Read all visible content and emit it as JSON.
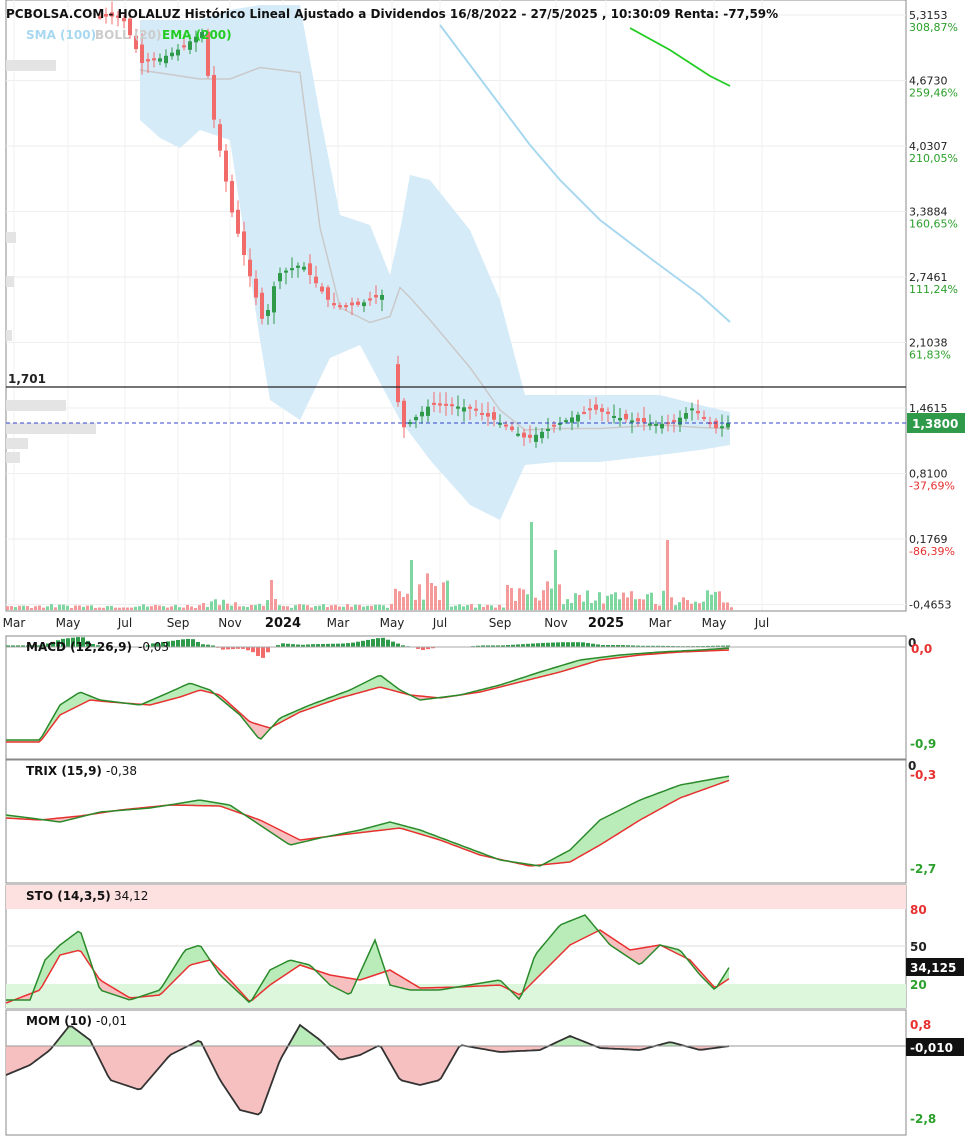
{
  "header": {
    "title": "PCBOLSA.COM - HOLALUZ Histórico Lineal Ajustado a Dividendos 16/8/2022 - 27/5/2025 , 10:30:09 Renta: -77,59%",
    "legend": [
      {
        "label": "SMA (100)",
        "color": "#a8d8f0"
      },
      {
        "label": "BOLL (20)",
        "color": "#cccccc"
      },
      {
        "label": "EMA (200)",
        "color": "#22cc22"
      }
    ]
  },
  "price_axis": [
    {
      "price": "5,3153",
      "pct": "308,87%"
    },
    {
      "price": "4,6730",
      "pct": "259,46%"
    },
    {
      "price": "4,0307",
      "pct": "210,05%"
    },
    {
      "price": "3,3884",
      "pct": "160,65%"
    },
    {
      "price": "2,7461",
      "pct": "111,24%"
    },
    {
      "price": "2,1038",
      "pct": "61,83%"
    },
    {
      "price": "1,4615",
      "pct": ""
    },
    {
      "price": "0,8100",
      "pct": "-37,69%"
    },
    {
      "price": "0,1769",
      "pct": "-86,39%"
    },
    {
      "price": "-0,4653",
      "pct": ""
    }
  ],
  "reference_line": {
    "label": "1,701"
  },
  "last_price": {
    "label": "1,3800",
    "color": "#2e9a4a"
  },
  "x_axis": {
    "months": [
      "Mar",
      "May",
      "Jul",
      "Sep",
      "Nov",
      "2024",
      "Mar",
      "May",
      "Jul",
      "Sep",
      "Nov",
      "2025",
      "Mar",
      "May",
      "Jul"
    ]
  },
  "macd": {
    "title": "MACD (12,26,9)",
    "value": "-0,03",
    "scale_top": "0",
    "scale_top_label": "0,0",
    "scale_bottom": "-0,9"
  },
  "trix": {
    "title": "TRIX (15,9)",
    "value": "-0,38",
    "scale_top": "0",
    "scale_top_label": "-0,3",
    "scale_bottom": "-2,7"
  },
  "sto": {
    "title": "STO (14,3,5)",
    "value": "34,12",
    "levels": [
      "80",
      "50",
      "20"
    ],
    "last": "34,125"
  },
  "mom": {
    "title": "MOM (10)",
    "value": "-0,01",
    "scale_top": "0,8",
    "scale_bottom": "-2,8",
    "last": "-0,010"
  },
  "chart_data": {
    "type": "candlestick",
    "title": "PCBOLSA.COM - HOLALUZ Histórico Lineal Ajustado a Dividendos 16/8/2022 - 27/5/2025 , 10:30:09 Renta: -77,59%",
    "y_range": [
      -0.4653,
      5.3153
    ],
    "reference_level": 1.701,
    "last_close": 1.38,
    "close_path": [
      {
        "t": "Mar 2023",
        "close": 5.3
      },
      {
        "t": "May 2023",
        "close": 5.3
      },
      {
        "t": "Jun 2023",
        "close": 4.85
      },
      {
        "t": "Jul 2023",
        "close": 4.9
      },
      {
        "t": "Aug 2023",
        "close": 5.0
      },
      {
        "t": "Sep 2023",
        "close": 5.15
      },
      {
        "t": "Sep 2023",
        "close": 4.3
      },
      {
        "t": "Oct 2023",
        "close": 3.4
      },
      {
        "t": "Nov 2023",
        "close": 2.3
      },
      {
        "t": "Dec 2023",
        "close": 2.8
      },
      {
        "t": "Jan 2024",
        "close": 2.9
      },
      {
        "t": "Feb 2024",
        "close": 2.5
      },
      {
        "t": "Mar 2024",
        "close": 2.5
      },
      {
        "t": "Apr 2024",
        "close": 2.6
      },
      {
        "t": "May 2024",
        "close": 1.3
      },
      {
        "t": "Jun 2024",
        "close": 1.55
      },
      {
        "t": "Jul 2024",
        "close": 1.5
      },
      {
        "t": "Aug 2024",
        "close": 1.35
      },
      {
        "t": "Sep 2024",
        "close": 1.2
      },
      {
        "t": "Oct 2024",
        "close": 1.35
      },
      {
        "t": "Nov 2024",
        "close": 1.5
      },
      {
        "t": "Dec 2024",
        "close": 1.4
      },
      {
        "t": "Jan 2025",
        "close": 1.35
      },
      {
        "t": "Feb 2025",
        "close": 1.35
      },
      {
        "t": "Mar 2025",
        "close": 1.5
      },
      {
        "t": "Apr 2025",
        "close": 1.3
      },
      {
        "t": "May 2025",
        "close": 1.38
      }
    ],
    "indicators": [
      "SMA (100)",
      "BOLL (20)",
      "EMA (200)",
      "MACD (12,26,9)",
      "TRIX (15,9)",
      "STO (14,3,5)",
      "MOM (10)"
    ]
  }
}
